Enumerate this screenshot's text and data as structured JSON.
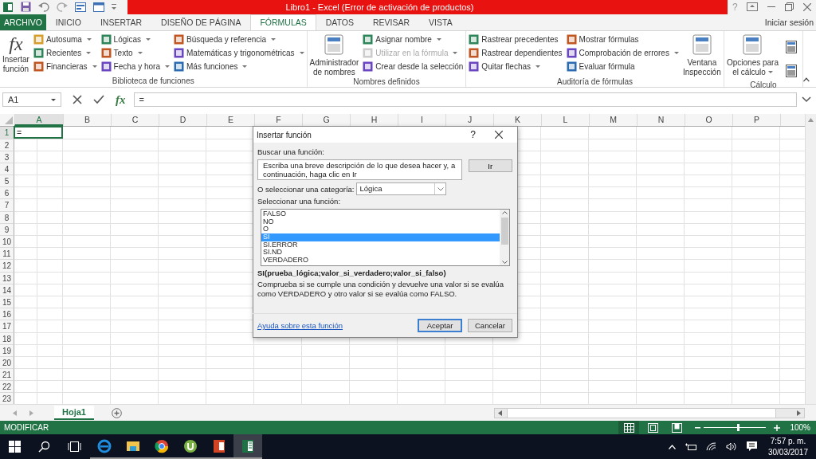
{
  "window": {
    "title": "Libro1 - Excel (Error de activación de productos)",
    "help": "?",
    "sign_in": "Iniciar sesión"
  },
  "tabs": [
    {
      "label": "ARCHIVO",
      "kind": "file",
      "selected": false
    },
    {
      "label": "INICIO",
      "kind": "tab",
      "selected": false
    },
    {
      "label": "INSERTAR",
      "kind": "tab",
      "selected": false
    },
    {
      "label": "DISEÑO DE PÁGINA",
      "kind": "tab",
      "selected": false
    },
    {
      "label": "FÓRMULAS",
      "kind": "tab",
      "selected": true
    },
    {
      "label": "DATOS",
      "kind": "tab",
      "selected": false
    },
    {
      "label": "REVISAR",
      "kind": "tab",
      "selected": false
    },
    {
      "label": "VISTA",
      "kind": "tab",
      "selected": false
    }
  ],
  "ribbon": {
    "groups": [
      {
        "label": "Biblioteca de funciones",
        "columns": [
          [
            {
              "label": "Insertar función",
              "kind": "big",
              "glyph": "fx",
              "dropdown": false,
              "disabled": false
            }
          ],
          [
            {
              "label": "Autosuma",
              "kind": "small",
              "dropdown": true,
              "disabled": false
            },
            {
              "label": "Recientes",
              "kind": "small",
              "dropdown": true,
              "disabled": false
            },
            {
              "label": "Financieras",
              "kind": "small",
              "dropdown": true,
              "disabled": false
            }
          ],
          [
            {
              "label": "Lógicas",
              "kind": "small",
              "dropdown": true,
              "disabled": false
            },
            {
              "label": "Texto",
              "kind": "small",
              "dropdown": true,
              "disabled": false
            },
            {
              "label": "Fecha y hora",
              "kind": "small",
              "dropdown": true,
              "disabled": false
            }
          ],
          [
            {
              "label": "Búsqueda y referencia",
              "kind": "small",
              "dropdown": true,
              "disabled": false
            },
            {
              "label": "Matemáticas y trigonométricas",
              "kind": "small",
              "dropdown": true,
              "disabled": false
            },
            {
              "label": "Más funciones",
              "kind": "small",
              "dropdown": true,
              "disabled": false
            }
          ]
        ]
      },
      {
        "label": "Nombres definidos",
        "columns": [
          [
            {
              "label": "Administrador de nombres",
              "kind": "big",
              "dropdown": false,
              "disabled": false
            }
          ],
          [
            {
              "label": "Asignar nombre",
              "kind": "small",
              "dropdown": true,
              "disabled": false
            },
            {
              "label": "Utilizar en la fórmula",
              "kind": "small",
              "dropdown": true,
              "disabled": true
            },
            {
              "label": "Crear desde la selección",
              "kind": "small",
              "dropdown": false,
              "disabled": false
            }
          ]
        ]
      },
      {
        "label": "Auditoría de fórmulas",
        "columns": [
          [
            {
              "label": "Rastrear precedentes",
              "kind": "small",
              "dropdown": false,
              "disabled": false
            },
            {
              "label": "Rastrear dependientes",
              "kind": "small",
              "dropdown": false,
              "disabled": false
            },
            {
              "label": "Quitar flechas",
              "kind": "small",
              "dropdown": true,
              "disabled": false
            }
          ],
          [
            {
              "label": "Mostrar fórmulas",
              "kind": "small",
              "dropdown": false,
              "disabled": false
            },
            {
              "label": "Comprobación de errores",
              "kind": "small",
              "dropdown": true,
              "disabled": false
            },
            {
              "label": "Evaluar fórmula",
              "kind": "small",
              "dropdown": false,
              "disabled": false
            }
          ],
          [
            {
              "label": "Ventana Inspección",
              "kind": "big",
              "dropdown": false,
              "disabled": false
            }
          ]
        ]
      },
      {
        "label": "Cálculo",
        "columns": [
          [
            {
              "label": "Opciones para el cálculo",
              "kind": "big",
              "dropdown": true,
              "disabled": false
            }
          ],
          [
            {
              "kind": "icon"
            },
            {
              "kind": "icon"
            }
          ]
        ]
      }
    ]
  },
  "formula_bar": {
    "name_box": "A1",
    "function_button": "fx",
    "formula": "="
  },
  "sheet": {
    "columns": [
      {
        "label": "A",
        "selected": true
      },
      {
        "label": "B",
        "selected": false
      },
      {
        "label": "C",
        "selected": false
      },
      {
        "label": "D",
        "selected": false
      },
      {
        "label": "E",
        "selected": false
      },
      {
        "label": "F",
        "selected": false
      },
      {
        "label": "G",
        "selected": false
      },
      {
        "label": "H",
        "selected": false
      },
      {
        "label": "I",
        "selected": false
      },
      {
        "label": "J",
        "selected": false
      },
      {
        "label": "K",
        "selected": false
      },
      {
        "label": "L",
        "selected": false
      },
      {
        "label": "M",
        "selected": false
      },
      {
        "label": "N",
        "selected": false
      },
      {
        "label": "O",
        "selected": false
      },
      {
        "label": "P",
        "selected": false
      }
    ],
    "rows": [
      {
        "label": "1",
        "selected": true
      },
      {
        "label": "2",
        "selected": false
      },
      {
        "label": "3",
        "selected": false
      },
      {
        "label": "4",
        "selected": false
      },
      {
        "label": "5",
        "selected": false
      },
      {
        "label": "6",
        "selected": false
      },
      {
        "label": "7",
        "selected": false
      },
      {
        "label": "8",
        "selected": false
      },
      {
        "label": "9",
        "selected": false
      },
      {
        "label": "10",
        "selected": false
      },
      {
        "label": "11",
        "selected": false
      },
      {
        "label": "12",
        "selected": false
      },
      {
        "label": "13",
        "selected": false
      },
      {
        "label": "14",
        "selected": false
      },
      {
        "label": "15",
        "selected": false
      },
      {
        "label": "16",
        "selected": false
      },
      {
        "label": "17",
        "selected": false
      },
      {
        "label": "18",
        "selected": false
      },
      {
        "label": "19",
        "selected": false
      },
      {
        "label": "20",
        "selected": false
      },
      {
        "label": "21",
        "selected": false
      },
      {
        "label": "22",
        "selected": false
      },
      {
        "label": "23",
        "selected": false
      }
    ],
    "active_cell": "="
  },
  "dialog": {
    "title": "Insertar función",
    "help": "?",
    "search_label": "Buscar una función:",
    "search_value": "Escriba una breve descripción de lo que desea hacer y, a continuación, haga clic en Ir",
    "go_button": "Ir",
    "category_label": "O seleccionar una categoría:",
    "category_value": "Lógica",
    "list_label": "Seleccionar una función:",
    "functions": [
      {
        "name": "FALSO",
        "selected": false
      },
      {
        "name": "NO",
        "selected": false
      },
      {
        "name": "O",
        "selected": false
      },
      {
        "name": "SI",
        "selected": true
      },
      {
        "name": "SI.ERROR",
        "selected": false
      },
      {
        "name": "SI.ND",
        "selected": false
      },
      {
        "name": "VERDADERO",
        "selected": false
      }
    ],
    "signature": "SI(prueba_lógica;valor_si_verdadero;valor_si_falso)",
    "description": "Comprueba si se cumple una condición y devuelve una valor si se evalúa como VERDADERO y otro valor si se evalúa como FALSO.",
    "help_link": "Ayuda sobre esta función",
    "buttons": [
      {
        "label": "Aceptar",
        "kind": "default"
      },
      {
        "label": "Cancelar",
        "kind": "normal"
      }
    ]
  },
  "sheet_tabs": [
    {
      "label": "Hoja1",
      "selected": true
    }
  ],
  "status_bar": {
    "mode": "MODIFICAR",
    "views": [
      {
        "kind": "normal",
        "selected": true
      },
      {
        "kind": "layout",
        "selected": false
      },
      {
        "kind": "pagebreak",
        "selected": false
      }
    ],
    "zoom": {
      "level": 0.55,
      "reading": "100%"
    }
  },
  "taskbar": {
    "apps": [
      {
        "kind": "browser",
        "selected": false
      },
      {
        "kind": "folder",
        "selected": false
      },
      {
        "kind": "globe",
        "selected": false
      },
      {
        "kind": "round",
        "selected": false
      },
      {
        "kind": "slides",
        "selected": false
      },
      {
        "kind": "sheet",
        "selected": true
      }
    ],
    "time": "7:57 p. m.",
    "date": "30/03/2017"
  }
}
